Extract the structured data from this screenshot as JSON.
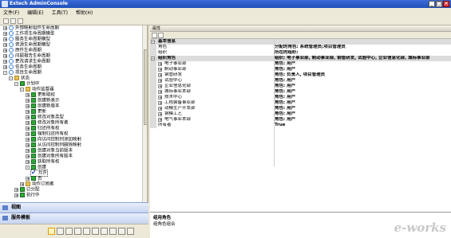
{
  "app": {
    "title": "Extech AdminConsole"
  },
  "window_controls": {
    "minimize": "_",
    "maximize": "□",
    "close": "×"
  },
  "menu": [
    "文件(F)",
    "编辑(E)",
    "工具(T)",
    "帮助(H)"
  ],
  "tree": [
    {
      "label": "外部映射组件生命周期",
      "level": 2,
      "expander": "+",
      "icon": "gear"
    },
    {
      "label": "工作项生命周期模型",
      "level": 2,
      "expander": "+",
      "icon": "gear"
    },
    {
      "label": "服务生命周期模型",
      "level": 2,
      "expander": "+",
      "icon": "gear"
    },
    {
      "label": "资源生命周期模型",
      "level": 2,
      "expander": "+",
      "icon": "gear"
    },
    {
      "label": "原件生命周期",
      "level": 2,
      "expander": "+",
      "icon": "gear"
    },
    {
      "label": "问题报告生命周期",
      "level": 2,
      "expander": "+",
      "icon": "gear"
    },
    {
      "label": "更改请求生命周期",
      "level": 2,
      "expander": "+",
      "icon": "gear"
    },
    {
      "label": "任务生命周期",
      "level": 2,
      "expander": "+",
      "icon": "gear"
    },
    {
      "label": "项目生命周期",
      "level": 2,
      "expander": "-",
      "icon": "gear"
    },
    {
      "label": "状态",
      "level": 3,
      "expander": "-",
      "icon": "folder"
    },
    {
      "label": "计划中",
      "level": 4,
      "expander": "-",
      "icon": "green"
    },
    {
      "label": "动作监督器",
      "level": 5,
      "expander": "-",
      "icon": "folder"
    },
    {
      "label": "更新取权",
      "level": 6,
      "expander": "+",
      "icon": "green"
    },
    {
      "label": "创建新表示",
      "level": 6,
      "expander": "+",
      "icon": "green"
    },
    {
      "label": "创建新版本",
      "level": 6,
      "expander": "+",
      "icon": "green"
    },
    {
      "label": "更新",
      "level": 6,
      "expander": "+",
      "icon": "green"
    },
    {
      "label": "修改对象类型",
      "level": 6,
      "expander": "+",
      "icon": "green"
    },
    {
      "label": "修改对象所有者",
      "level": 6,
      "expander": "+",
      "icon": "green"
    },
    {
      "label": "归还所有权",
      "level": 6,
      "expander": "+",
      "icon": "green"
    },
    {
      "label": "强制归还所有权",
      "level": 6,
      "expander": "+",
      "icon": "green"
    },
    {
      "label": "向访问控制列添加映射",
      "level": 6,
      "expander": "+",
      "icon": "green"
    },
    {
      "label": "从访问控制列删除映射",
      "level": 6,
      "expander": "+",
      "icon": "green"
    },
    {
      "label": "创建对象当前版本",
      "level": 6,
      "expander": "+",
      "icon": "green"
    },
    {
      "label": "创建对象所有版本",
      "level": 6,
      "expander": "+",
      "icon": "green"
    },
    {
      "label": "获取所有权",
      "level": 6,
      "expander": "+",
      "icon": "green"
    },
    {
      "label": "创建",
      "level": 6,
      "expander": "-",
      "icon": "green"
    },
    {
      "label": "允许",
      "level": 7,
      "expander": "",
      "icon": "check",
      "selected": true
    },
    {
      "label": "否",
      "level": 6,
      "expander": "+",
      "icon": "green"
    },
    {
      "label": "动作订阅者",
      "level": 5,
      "expander": "+",
      "icon": "folder"
    },
    {
      "label": "已分配",
      "level": 4,
      "expander": "+",
      "icon": "green"
    },
    {
      "label": "执行中",
      "level": 4,
      "expander": "+",
      "icon": "green"
    }
  ],
  "panels": {
    "view": "视图",
    "services": "服务模板"
  },
  "properties_header": "属性",
  "properties": [
    {
      "name": "基本信息",
      "value": "",
      "type": "category",
      "expander": "-"
    },
    {
      "name": "角色",
      "value": "分配的角色: 系统管理员;项目管理员",
      "type": "row"
    },
    {
      "name": "组织",
      "value": "所在的组织:",
      "type": "row"
    },
    {
      "name": "组织角色",
      "value": "组织: 电子事业部, 制动事业部, 钢管研发, 试验中心, 企业信息化部, 城际事业部",
      "type": "category",
      "expander": "-"
    },
    {
      "name": "电子事业部",
      "value": "角色: 用户",
      "type": "sub",
      "expander": "+"
    },
    {
      "name": "制动事业部",
      "value": "角色: 用户",
      "type": "sub",
      "expander": "+"
    },
    {
      "name": "钢管研发",
      "value": "角色: 负责人, 项目管理员",
      "type": "sub",
      "expander": "+"
    },
    {
      "name": "试验中心",
      "value": "角色: 用户",
      "type": "sub",
      "expander": "+"
    },
    {
      "name": "企业信息化部",
      "value": "角色: 用户",
      "type": "sub",
      "expander": "+"
    },
    {
      "name": "城际事业本部",
      "value": "角色: 用户",
      "type": "sub",
      "expander": "+"
    },
    {
      "name": "技术中心",
      "value": "角色: 用户",
      "type": "sub",
      "expander": "+"
    },
    {
      "name": "工程装备事业部",
      "value": "角色: 用户",
      "type": "sub",
      "expander": "+"
    },
    {
      "name": "动模生产开发部",
      "value": "角色: 用户",
      "type": "sub",
      "expander": "+"
    },
    {
      "name": "钢模工艺",
      "value": "角色: 用户",
      "type": "sub",
      "expander": "+"
    },
    {
      "name": "电气事业本部",
      "value": "角色: 用户",
      "type": "sub",
      "expander": "+"
    },
    {
      "name": "所有者",
      "value": "True",
      "type": "row"
    }
  ],
  "description": {
    "title": "组用角色",
    "text": "组角色组合"
  },
  "watermark": "e-works"
}
